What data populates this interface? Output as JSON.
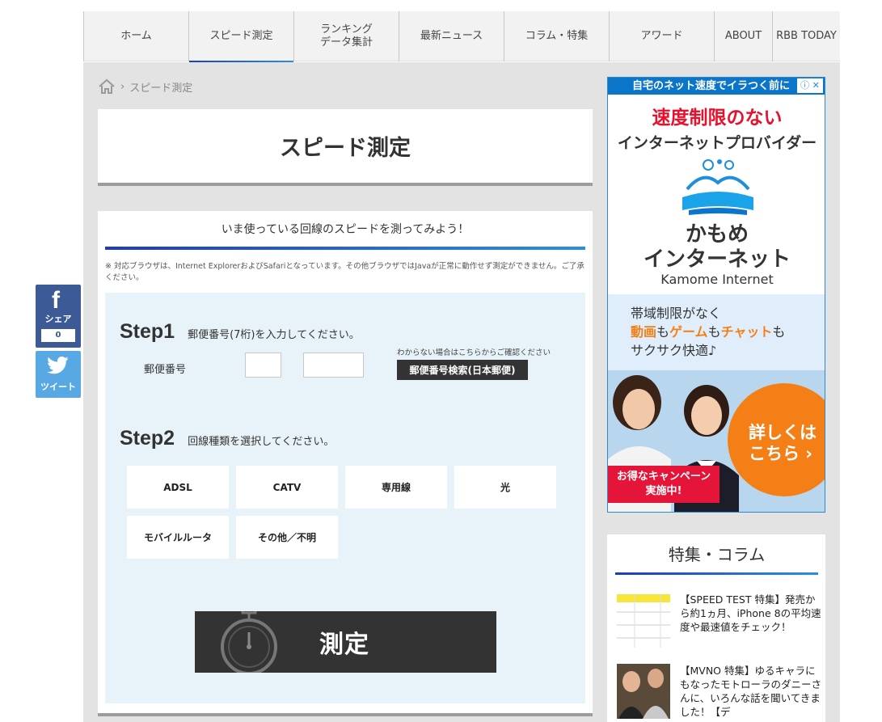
{
  "nav": {
    "items": [
      {
        "label": "ホーム"
      },
      {
        "label": "スピード測定"
      },
      {
        "label": "ランキング\nデータ集計"
      },
      {
        "label": "最新ニュース"
      },
      {
        "label": "コラム・特集"
      },
      {
        "label": "アワード"
      },
      {
        "label": "ABOUT"
      },
      {
        "label": "RBB TODAY"
      }
    ]
  },
  "breadcrumb": {
    "current": "スピード測定",
    "separator": "›"
  },
  "page_title": "スピード測定",
  "main": {
    "heading": "いま使っている回線のスピードを測ってみよう！",
    "notice": "※ 対応ブラウザは、Internet ExplorerおよびSafariとなっています。その他ブラウザではJavaが正常に動作せず測定ができません。ご了承ください。",
    "step1": {
      "number": "Step1",
      "desc": "郵便番号(7桁)を入力してください。"
    },
    "zip": {
      "label": "郵便番号",
      "part1": "",
      "part2": "",
      "hint": "わからない場合はこちらからご確認ください",
      "button": "郵便番号検索(日本郵便)"
    },
    "step2": {
      "number": "Step2",
      "desc": "回線種類を選択してください。"
    },
    "line_types": [
      "ADSL",
      "CATV",
      "専用線",
      "光",
      "モバイルルータ",
      "その他／不明"
    ],
    "measure_label": "測定"
  },
  "social": {
    "facebook_label": "シェア",
    "facebook_count": "0",
    "twitter_label": "ツイート"
  },
  "ad": {
    "top_banner": "自宅のネット速度でイラつく前に",
    "headline1": "速度制限のない",
    "headline2": "インターネットプロバイダー",
    "brand_line1": "かもめ",
    "brand_line2": "インターネット",
    "brand_en": "Kamome Internet",
    "line1": "帯域制限がなく",
    "line2_parts": [
      "動画",
      "も",
      "ゲーム",
      "も",
      "チャット",
      "も"
    ],
    "line3": "サクサク快適♪",
    "cta": "詳しくは\nこちら ›",
    "campaign": "お得なキャンペーン\n実施中!",
    "colors": {
      "accent": "#e8112d",
      "orange": "#f57f17",
      "blue": "#0b75c9"
    }
  },
  "feature": {
    "title": "特集・コラム",
    "items": [
      {
        "text": "【SPEED TEST 特集】発売から約1ヵ月、iPhone 8の平均速度や最速値をチェック！"
      },
      {
        "text": "【MVNO 特集】ゆるキャラにもなったモトローラのダニーさんに、いろんな話を聞いてきました！【デ"
      }
    ]
  }
}
